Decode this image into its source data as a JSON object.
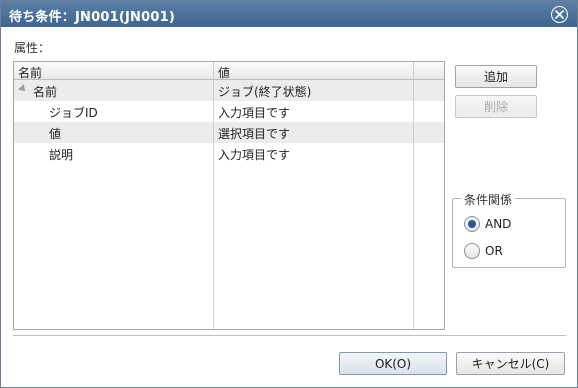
{
  "window": {
    "title": "待ち条件：JN001(JN001)"
  },
  "attributes_label": "属性：",
  "grid": {
    "columns": [
      "名前",
      "値"
    ],
    "rows": [
      {
        "name": "名前",
        "value": "ジョブ(終了状態)",
        "level": 0,
        "expandable": true
      },
      {
        "name": "ジョブID",
        "value": "入力項目です",
        "level": 1
      },
      {
        "name": "値",
        "value": "選択項目です",
        "level": 1
      },
      {
        "name": "説明",
        "value": "入力項目です",
        "level": 1
      }
    ]
  },
  "side_buttons": {
    "add": "追加",
    "delete": "削除"
  },
  "condition": {
    "legend": "条件関係",
    "options": [
      {
        "label": "AND",
        "checked": true
      },
      {
        "label": "OR",
        "checked": false
      }
    ]
  },
  "footer": {
    "ok": "OK(O)",
    "cancel": "キャンセル(C)"
  }
}
